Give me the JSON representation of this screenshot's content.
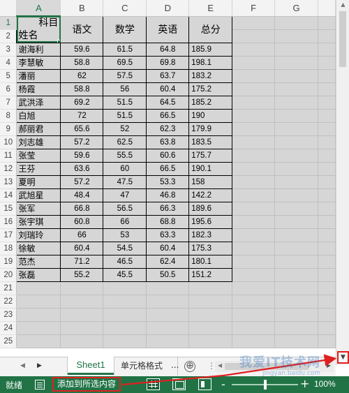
{
  "columns": [
    "A",
    "B",
    "C",
    "D",
    "E",
    "F",
    "G"
  ],
  "row_numbers": [
    "1",
    "2",
    "3",
    "4",
    "5",
    "6",
    "7",
    "8",
    "9",
    "10",
    "11",
    "12",
    "13",
    "14",
    "15",
    "16",
    "17",
    "18",
    "19",
    "20",
    "21",
    "22",
    "23",
    "24",
    "25"
  ],
  "table": {
    "header_top": "科目",
    "header_bottom": "姓名",
    "subjects": [
      "语文",
      "数学",
      "英语",
      "总分"
    ],
    "rows": [
      [
        "谢海利",
        "59.6",
        "61.5",
        "64.8",
        "185.9"
      ],
      [
        "李慧敏",
        "58.8",
        "69.5",
        "69.8",
        "198.1"
      ],
      [
        "潘丽",
        "62",
        "57.5",
        "63.7",
        "183.2"
      ],
      [
        "杨霞",
        "58.8",
        "56",
        "60.4",
        "175.2"
      ],
      [
        "武洪泽",
        "69.2",
        "51.5",
        "64.5",
        "185.2"
      ],
      [
        "白旭",
        "72",
        "51.5",
        "66.5",
        "190"
      ],
      [
        "郝丽君",
        "65.6",
        "52",
        "62.3",
        "179.9"
      ],
      [
        "刘志雄",
        "57.2",
        "62.5",
        "63.8",
        "183.5"
      ],
      [
        "张莹",
        "59.6",
        "55.5",
        "60.6",
        "175.7"
      ],
      [
        "王芬",
        "63.6",
        "60",
        "66.5",
        "190.1"
      ],
      [
        "夏明",
        "57.2",
        "47.5",
        "53.3",
        "158"
      ],
      [
        "武旭星",
        "48.4",
        "47",
        "46.8",
        "142.2"
      ],
      [
        "张军",
        "66.8",
        "56.5",
        "66.3",
        "189.6"
      ],
      [
        "张宇琪",
        "60.8",
        "66",
        "68.8",
        "195.6"
      ],
      [
        "刘瑞玲",
        "66",
        "53",
        "63.3",
        "182.3"
      ],
      [
        "徐敏",
        "60.4",
        "54.5",
        "60.4",
        "175.3"
      ],
      [
        "范杰",
        "71.2",
        "46.5",
        "62.4",
        "180.1"
      ],
      [
        "张磊",
        "55.2",
        "45.5",
        "50.5",
        "151.2"
      ]
    ]
  },
  "tabs": {
    "sheet1": "Sheet1",
    "sheet2": "单元格格式",
    "more": "...",
    "add": "⊕",
    "split": "⋮"
  },
  "status": {
    "ready": "就绪",
    "add_to_selection": "添加到所选内容",
    "zoom_minus": "-",
    "zoom_plus": "+",
    "zoom_level": "100%",
    "zoom_fraction": 0.5
  },
  "watermark": {
    "text": "我爱IT技术网",
    "url": "jingyan.baidu.com"
  },
  "colors": {
    "excel_green": "#217346",
    "highlight_red": "#e02020",
    "selection_gray": "#d6d6d6"
  },
  "icons": {
    "scroll_up": "▲",
    "scroll_down": "▼",
    "tab_prev": "◀",
    "tab_next": "▶",
    "hs_left": "◀",
    "hs_right": "▶"
  }
}
